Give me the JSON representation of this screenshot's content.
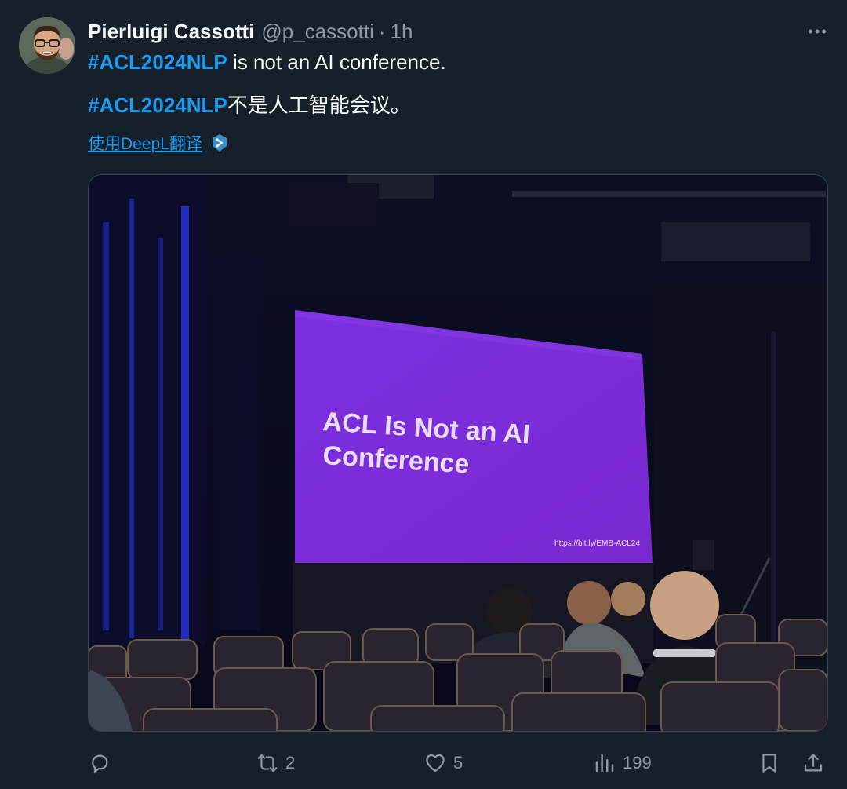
{
  "tweet": {
    "author_name": "Pierluigi Cassotti",
    "author_handle": "@p_cassotti",
    "separator": "·",
    "time": "1h",
    "line1_hashtag": "#ACL2024NLP",
    "line1_text": " is not an AI conference.",
    "line2_hashtag": "#ACL2024NLP",
    "line2_text": "不是人工智能会议。",
    "translate_label": "使用DeepL翻译"
  },
  "media": {
    "slide_title_line1": "ACL Is Not an AI",
    "slide_title_line2": "Conference",
    "slide_url": "https://bit.ly/EMB-ACL24"
  },
  "actions": {
    "retweet_count": "2",
    "like_count": "5",
    "view_count": "199"
  },
  "icons": {
    "more": "more-dots-icon",
    "reply": "reply-icon",
    "retweet": "retweet-icon",
    "like": "heart-icon",
    "views": "views-icon",
    "bookmark": "bookmark-icon",
    "share": "share-icon",
    "translate": "deepl-icon"
  },
  "colors": {
    "background": "#15202b",
    "accent": "#1d9bf0",
    "secondary_text": "#8b98a5",
    "slide_purple": "#7a2fd6"
  }
}
